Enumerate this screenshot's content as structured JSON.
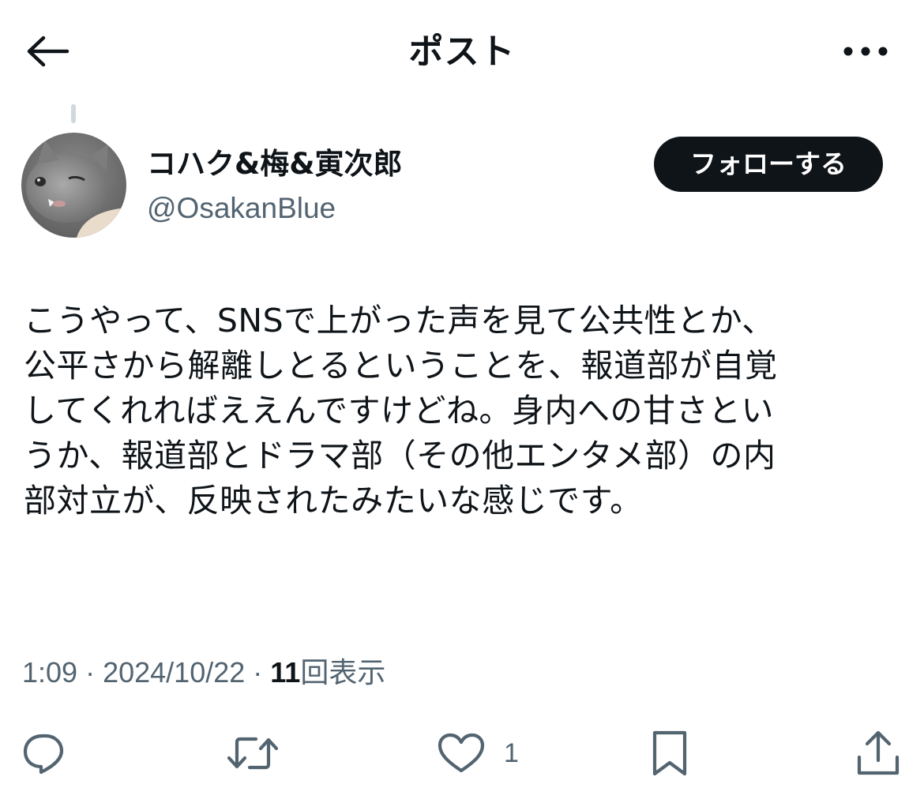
{
  "header": {
    "title": "ポスト",
    "back_icon": "arrow-left-icon",
    "more_icon": "more-horizontal-icon"
  },
  "author": {
    "display_name": "コハク&梅&寅次郎",
    "handle": "@OsakanBlue",
    "avatar": "gray-cat-avatar",
    "follow_label": "フォローする"
  },
  "post": {
    "lines": [
      "こうやって、SNSで上がった声を見て公共性とか、",
      "公平さから解離しとるということを、報道部が自覚",
      "してくれればええんですけどね。身内への甘さとい",
      "うか、報道部とドラマ部（その他エンタメ部）の内",
      "部対立が、反映されたみたいな感じです。"
    ]
  },
  "meta": {
    "time": "1:09",
    "separator": " · ",
    "date": "2024/10/22",
    "views_count": "11",
    "views_label": "回表示"
  },
  "actions": {
    "reply_icon": "reply-icon",
    "repost_icon": "repost-icon",
    "like_icon": "heart-icon",
    "like_count": "1",
    "bookmark_icon": "bookmark-icon",
    "share_icon": "share-icon"
  },
  "colors": {
    "text_primary": "#0f1419",
    "text_secondary": "#536471",
    "button_bg": "#0f1419",
    "thread_line": "#cfd9de"
  }
}
